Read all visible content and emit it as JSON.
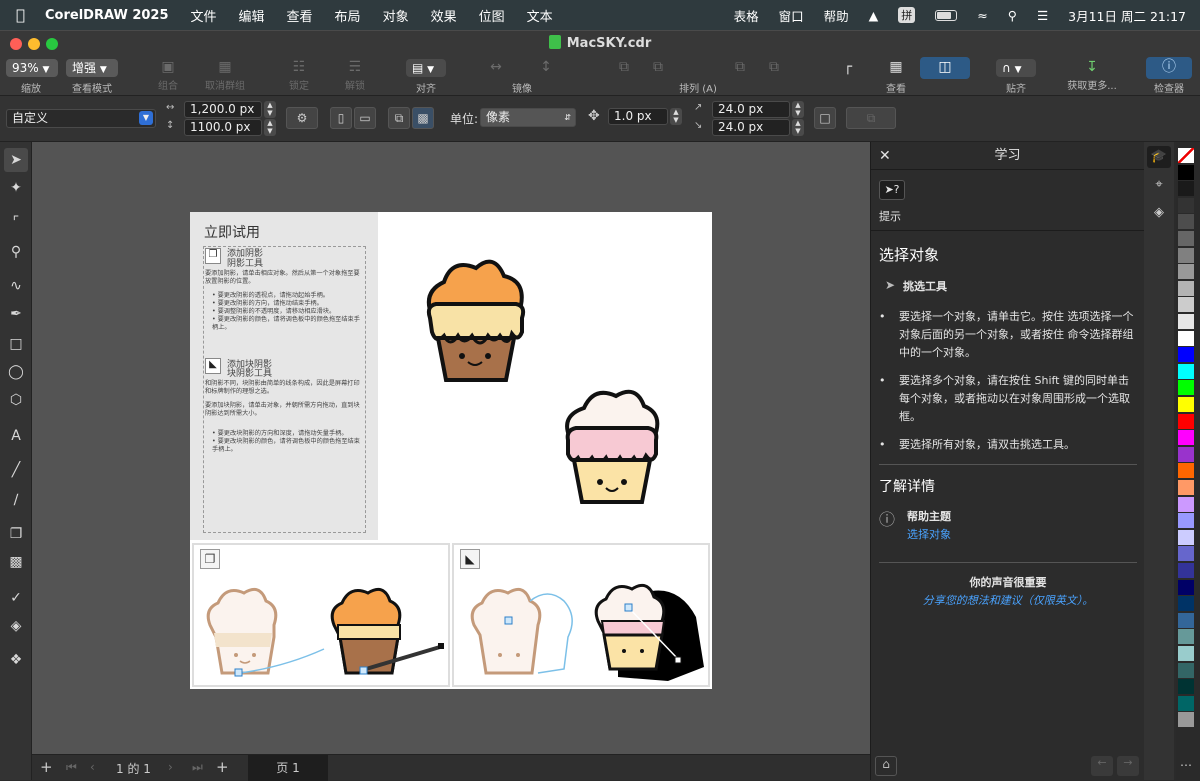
{
  "menubar": {
    "app": "CorelDRAW 2025",
    "items": [
      "文件",
      "编辑",
      "查看",
      "布局",
      "对象",
      "效果",
      "位图",
      "文本"
    ],
    "right": [
      "表格",
      "窗口",
      "帮助"
    ],
    "ime": "拼",
    "datetime": "3月11日 周二  21:17"
  },
  "window": {
    "title": "MacSKY.cdr"
  },
  "toolbar": {
    "zoom": "93%",
    "zoom_label": "缩放",
    "view_mode": "增强",
    "view_mode_label": "查看模式",
    "group": "组合",
    "ungroup": "取消群组",
    "lock": "锁定",
    "unlock": "解锁",
    "align": "对齐",
    "mirror": "镜像",
    "arrange": "排列 (A)",
    "view": "查看",
    "snap": "贴齐",
    "get_more": "获取更多...",
    "inspector": "检查器"
  },
  "propbar": {
    "preset": "自定义",
    "width": "1,200.0 px",
    "height": "1100.0 px",
    "unit_label": "单位:",
    "unit": "像素",
    "nudge": "1.0 px",
    "dup_x": "24.0 px",
    "dup_y": "24.0 px"
  },
  "statusbar": {
    "page_of": "1  的  1",
    "page_tab": "页 1"
  },
  "learn": {
    "header": "学习",
    "hints_label": "提示",
    "section_title": "选择对象",
    "tool_name": "挑选工具",
    "bullets": [
      "要选择一个对象，请单击它。按住 选项选择一个对象后面的另一个对象，或者按住 命令选择群组中的一个对象。",
      "要选择多个对象，请在按住 Shift 键的同时单击每个对象，或者拖动以在对象周围形成一个选取框。",
      "要选择所有对象，请双击挑选工具。"
    ],
    "learn_more": "了解详情",
    "help_topic": "帮助主题",
    "help_link": "选择对象",
    "feedback_title": "你的声音很重要",
    "feedback_link": "分享您的想法和建议（仅限英文）。"
  },
  "doc": {
    "try_now": "立即试用",
    "s1_title": "添加阴影",
    "s1_sub": "阴影工具",
    "s1_intro": "要添加阴影，请单击相应对象。然后从第一个对象拖至要放置阴影的位置。",
    "s1_bullets": [
      "要更改阴影的透视点，请拖动起始手柄。",
      "要更改阴影的方向，请拖动结束手柄。",
      "要调整阴影的不透明度，请移动相应滑块。",
      "要更改阴影的颜色，请将调色板中的颜色拖至结束手柄上。"
    ],
    "s2_title": "添加块阴影",
    "s2_sub": "块阴影工具",
    "s2_intro": "和阴影不同，块阴影由简单的线条构成，因此是屏幕打印和标牌制作的理想之选。",
    "s2_intro2": "要添加块阴影，请单击对象，并朝所需方向拖动，直到块阴影达到所需大小。",
    "s2_bullets": [
      "要更改块阴影的方向和深度，请拖动矢量手柄。",
      "要更改块阴影的颜色，请将调色板中的颜色拖至结束手柄上。"
    ]
  },
  "palette": [
    "#ffffff",
    "#000000",
    "#1a1a1a",
    "#333333",
    "#4d4d4d",
    "#666666",
    "#808080",
    "#999999",
    "#b3b3b3",
    "#cccccc",
    "#e6e6e6",
    "#ffffff",
    "#0000ff",
    "#00ffff",
    "#00ff00",
    "#ffff00",
    "#ff0000",
    "#ff00ff",
    "#9933cc",
    "#ff6600",
    "#ff9966",
    "#cc99ff",
    "#9999ff",
    "#ccccff",
    "#6666cc",
    "#333399",
    "#000066",
    "#003366",
    "#336699",
    "#669999",
    "#99cccc",
    "#336666",
    "#003333",
    "#006666",
    "#999999"
  ]
}
